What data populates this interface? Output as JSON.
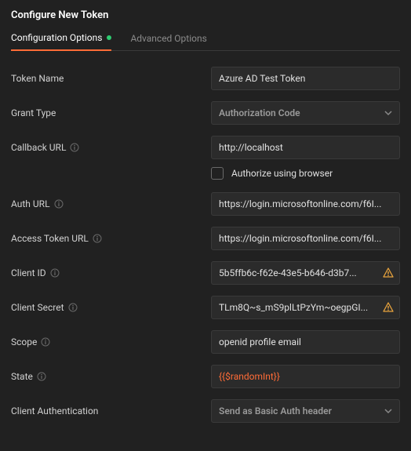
{
  "title": "Configure New Token",
  "tabs": {
    "config": "Configuration Options",
    "advanced": "Advanced Options"
  },
  "labels": {
    "tokenName": "Token Name",
    "grantType": "Grant Type",
    "callbackUrl": "Callback URL",
    "authorizeBrowser": "Authorize using browser",
    "authUrl": "Auth URL",
    "accessTokenUrl": "Access Token URL",
    "clientId": "Client ID",
    "clientSecret": "Client Secret",
    "scope": "Scope",
    "state": "State",
    "clientAuth": "Client Authentication"
  },
  "values": {
    "tokenName": "Azure AD Test Token",
    "grantType": "Authorization Code",
    "callbackUrl": "http://localhost",
    "authUrl": "https://login.microsoftonline.com/f6I...",
    "accessTokenUrl": "https://login.microsoftonline.com/f6I...",
    "clientId": "5b5ffb6c-f62e-43e5-b646-d3b7...",
    "clientSecret": "TLm8Q~s_mS9plLtPzYm~oegpGI...",
    "scope": "openid profile email",
    "state": "{{$randomInt}}",
    "clientAuth": "Send as Basic Auth header"
  }
}
